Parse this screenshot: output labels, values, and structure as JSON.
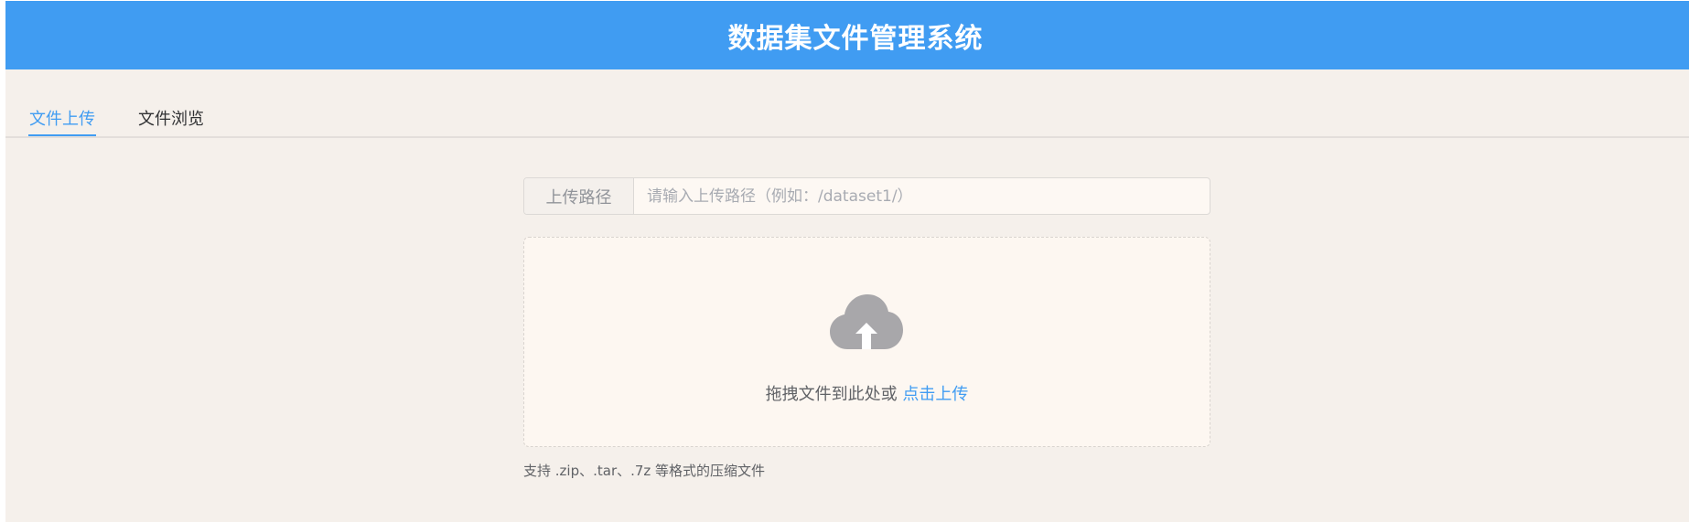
{
  "header": {
    "title": "数据集文件管理系统"
  },
  "tabs": [
    {
      "label": "文件上传",
      "active": true
    },
    {
      "label": "文件浏览",
      "active": false
    }
  ],
  "upload": {
    "path_label": "上传路径",
    "path_value": "",
    "path_placeholder": "请输入上传路径（例如：/dataset1/）",
    "cloud_icon": "cloud-upload-icon",
    "drop_text": "拖拽文件到此处或 ",
    "drop_link": "点击上传",
    "hint": "支持 .zip、.tar、.7z 等格式的压缩文件"
  },
  "colors": {
    "primary": "#409cf2",
    "background": "#f5f0eb",
    "header_text": "#ffffff",
    "icon_gray": "#a8a7aa"
  }
}
